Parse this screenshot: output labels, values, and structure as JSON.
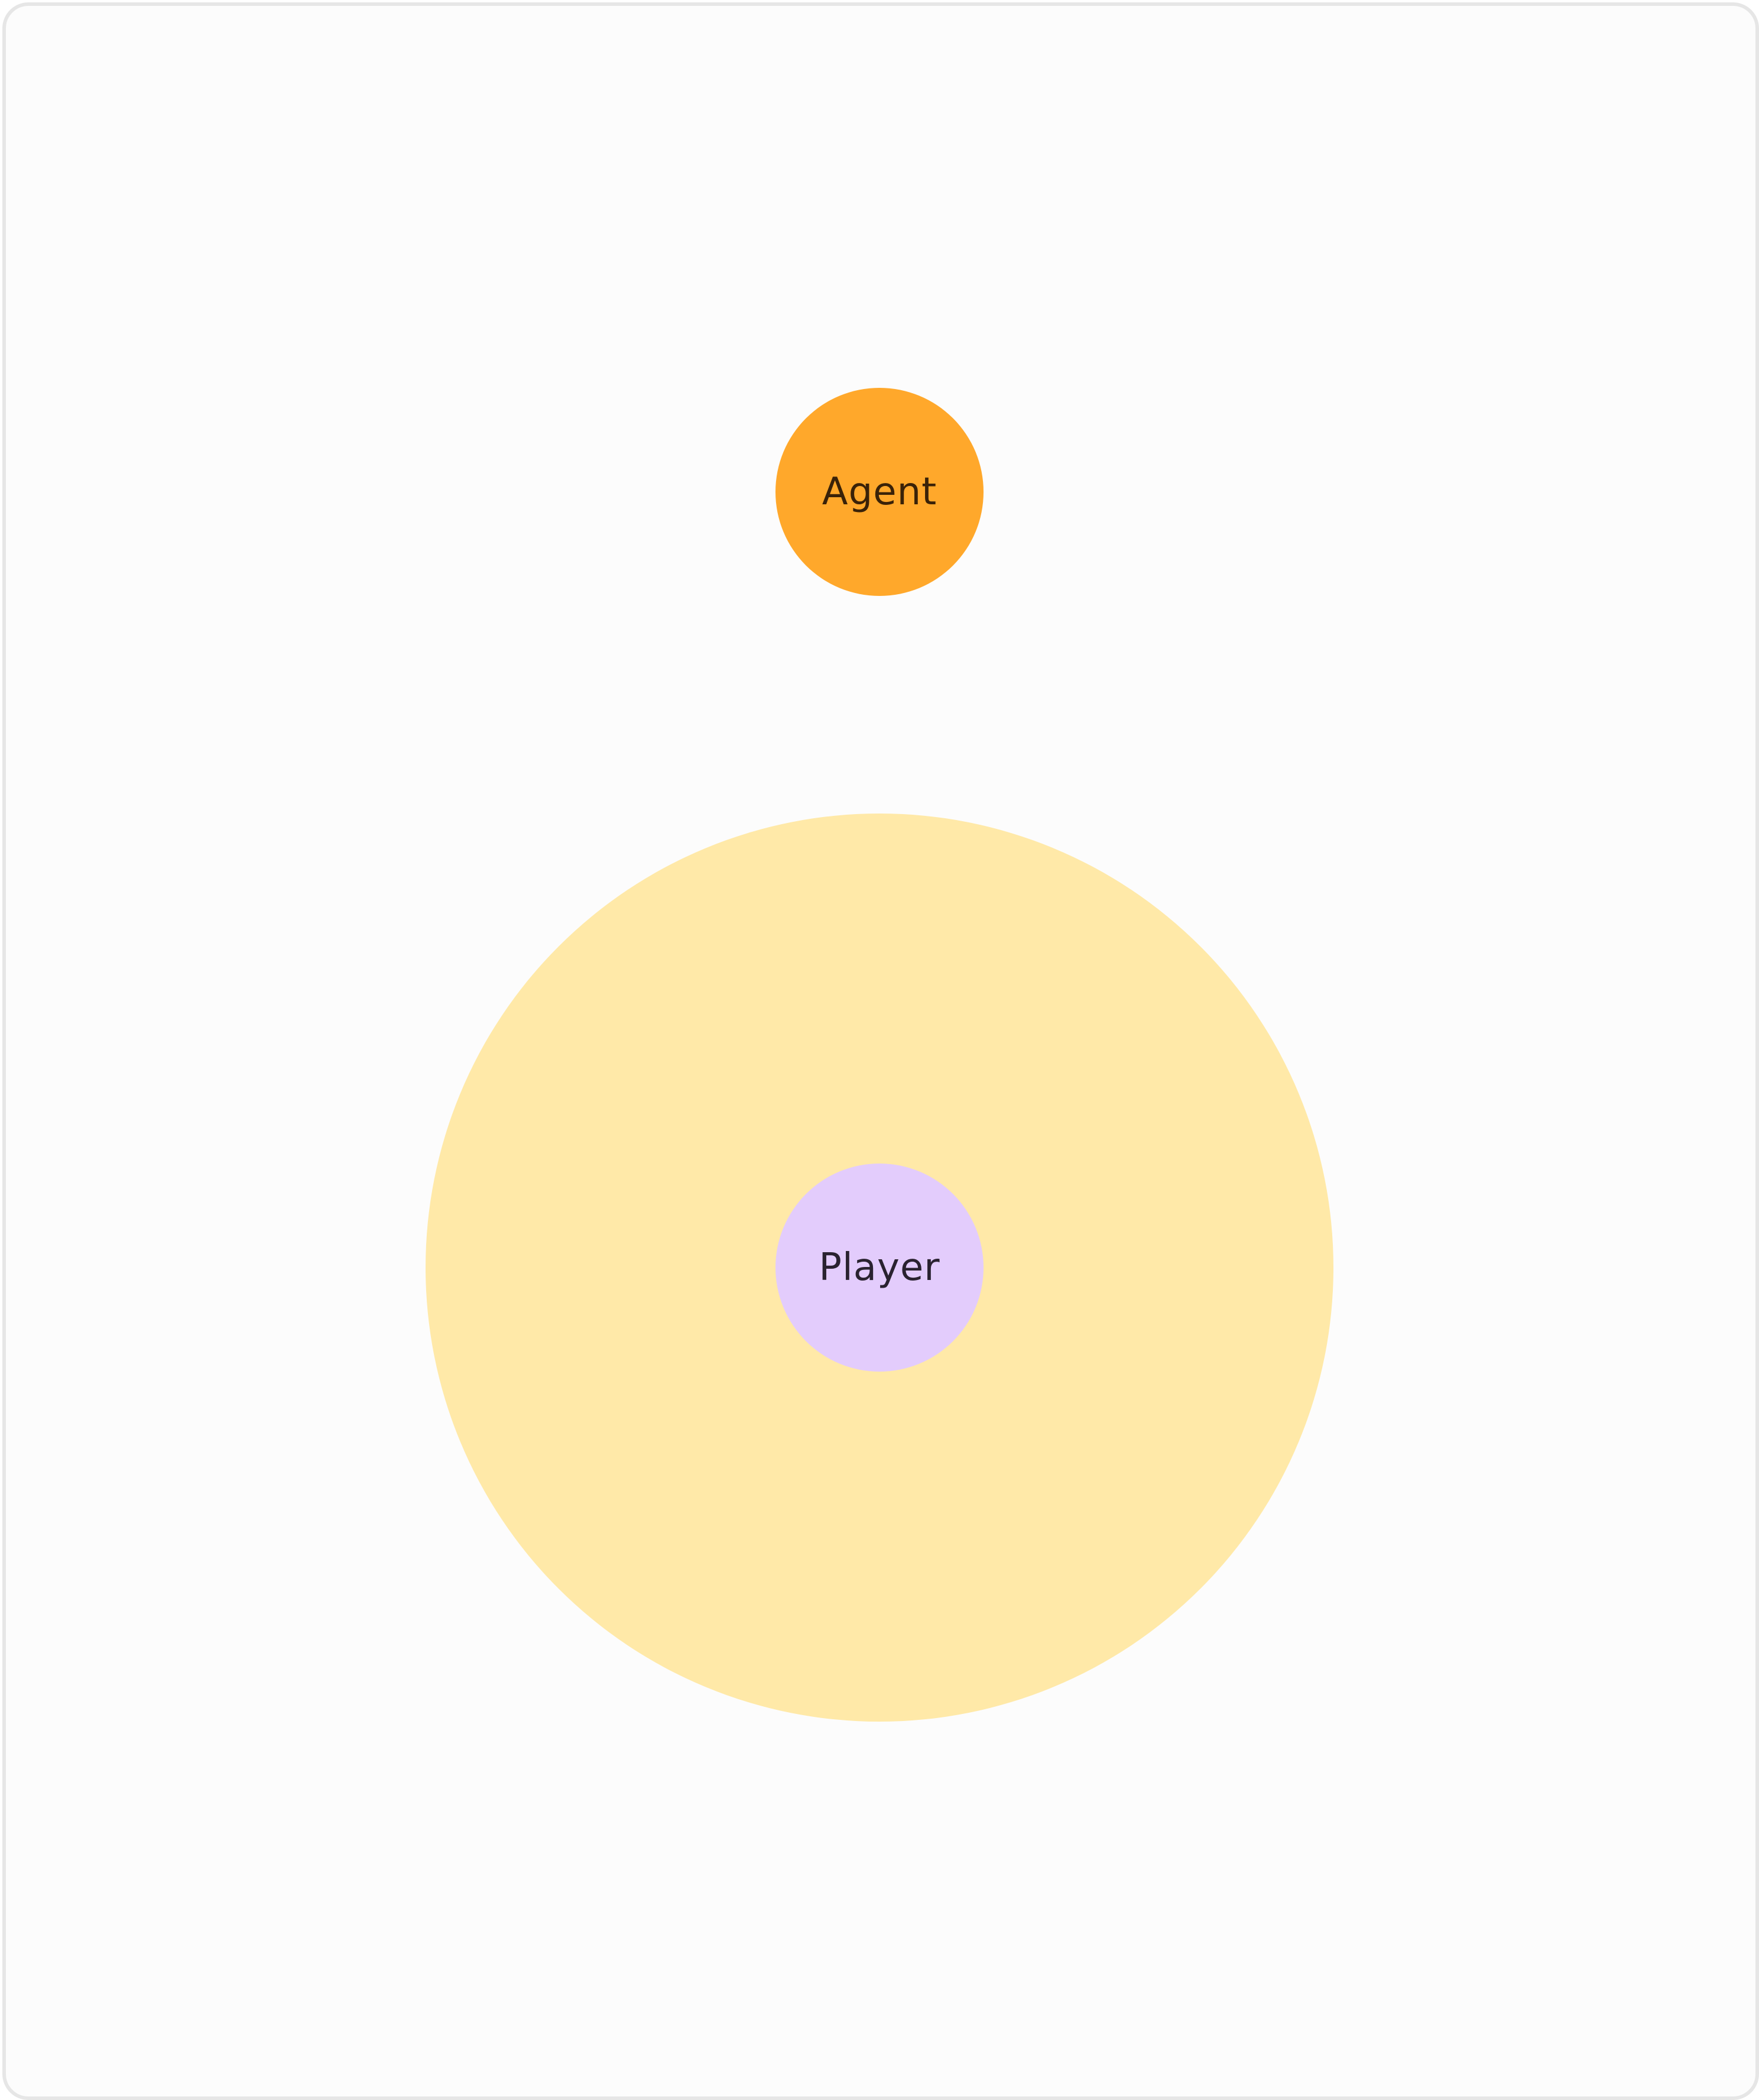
{
  "nodes": {
    "agent": {
      "label": "Agent",
      "color": "#FFA82B",
      "text_color": "#3A2208"
    },
    "player": {
      "label": "Player",
      "color": "#E3CCFC",
      "text_color": "#2A2230"
    }
  },
  "range_zone": {
    "color": "#FFE9A8"
  },
  "frame": {
    "background": "#FCFCFC",
    "border_color": "#E6E6E6"
  }
}
